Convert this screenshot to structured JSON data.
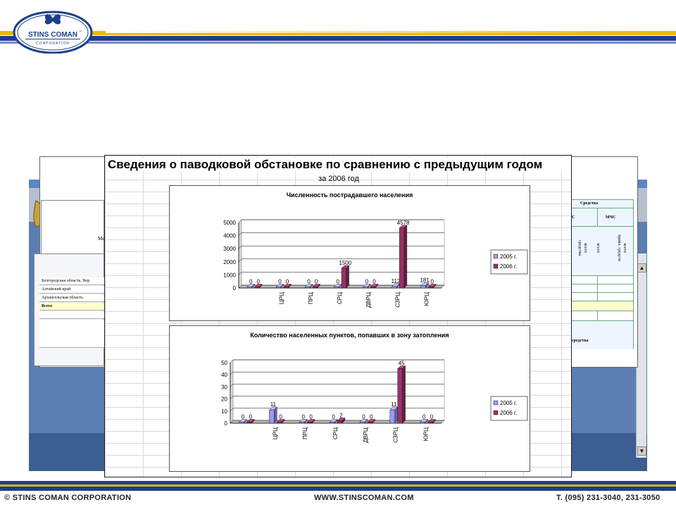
{
  "header": {
    "logo_main": "STINS COMAN",
    "logo_sub": "CORPORATION",
    "logo_tm": "TM"
  },
  "footer": {
    "copyright": "© STINS COMAN CORPORATION",
    "website": "WWW.STINSCOMAN.COM",
    "phone": "T. (095) 231-3040, 231-3050"
  },
  "background_sheet": {
    "left_label_partial": "Ме",
    "rows": [
      "Белгородская область, Вор",
      "Алтайский край",
      "Архангельская область",
      "Всего"
    ],
    "right_header": "Средства",
    "right_sub_a": "С",
    "right_sub_b": "МЧС",
    "right_col_labels": [
      "средства",
      "всего",
      "всего",
      "привл. средств",
      "всего"
    ],
    "right_footer": "средства"
  },
  "popup": {
    "title": "Сведения о паводковой обстановке по сравнению с предыдущим годом",
    "subtitle": "за 2006 год"
  },
  "colors": {
    "series_2005": "#9999ff",
    "series_2006": "#993366",
    "brand_blue": "#1a3f8c",
    "brand_yellow": "#f2b400"
  },
  "chart_data": [
    {
      "type": "bar",
      "title": "Численность пострадавшего населения",
      "categories": [
        "",
        "ЦРЦ",
        "ПРЦ",
        "СРЦ",
        "ДВРЦ",
        "СЗРЦ",
        "ЮРЦ"
      ],
      "series": [
        {
          "name": "2005 г.",
          "values": [
            0,
            0,
            0,
            0,
            0,
            112,
            181
          ]
        },
        {
          "name": "2006 г.",
          "values": [
            0,
            0,
            0,
            1500,
            0,
            4578,
            0
          ]
        }
      ],
      "ylim": [
        0,
        5000
      ],
      "yticks": [
        0,
        1000,
        2000,
        3000,
        4000,
        5000
      ],
      "legend": "right",
      "grid": true
    },
    {
      "type": "bar",
      "title": "Количество населенных пунктов, попавших в зону затопления",
      "categories": [
        "",
        "ЦРЦ",
        "ПРЦ",
        "СРЦ",
        "ДВРЦ",
        "СЗРЦ",
        "ЮРЦ"
      ],
      "series": [
        {
          "name": "2005 г.",
          "values": [
            0,
            11,
            0,
            0,
            0,
            11,
            0
          ]
        },
        {
          "name": "2006 г.",
          "values": [
            0,
            0,
            0,
            2,
            0,
            45,
            0
          ]
        }
      ],
      "ylim": [
        0,
        50
      ],
      "yticks": [
        0,
        10,
        20,
        30,
        40,
        50
      ],
      "legend": "right",
      "grid": true
    }
  ]
}
